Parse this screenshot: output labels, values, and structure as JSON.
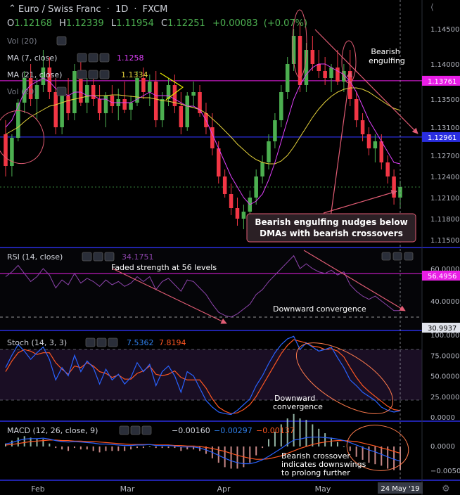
{
  "header": {
    "symbol": "Euro / Swiss Franc",
    "interval": "1D",
    "exchange": "FXCM",
    "open": "1.12168",
    "high": "1.12339",
    "low": "1.11954",
    "close": "1.12251",
    "change": "+0.00083",
    "change_pct": "(+0.07%)"
  },
  "indicators": {
    "vol1": "Vol (20)",
    "ma7": "MA (7, close)",
    "ma7_val": "1.1258",
    "ma21": "MA (21, close)",
    "ma21_val": "1.1334",
    "vol2": "Vol (20)",
    "rsi": "RSI (14, close)",
    "rsi_val": "34.1751",
    "stoch": "Stoch (14, 3, 3)",
    "stoch_k": "7.5362",
    "stoch_d": "7.8194",
    "macd": "MACD (12, 26, close, 9)",
    "macd_hist": "−0.00160",
    "macd_line": "−0.00297",
    "macd_signal": "−0.00137"
  },
  "price_axis": {
    "ticks": [
      "1.14500",
      "1.14000",
      "1.13500",
      "1.13100",
      "1.12700",
      "1.12400",
      "1.12100",
      "1.11800",
      "1.11500"
    ],
    "label_magenta": "1.13761",
    "label_blue": "1.12961"
  },
  "rsi_axis": {
    "ticks": [
      "60.0000",
      "40.0000"
    ],
    "label_magenta": "56.4956",
    "label_white": "30.9937"
  },
  "stoch_axis": {
    "ticks": [
      "100.0000",
      "75.0000",
      "50.0000",
      "25.0000",
      "0.0000"
    ]
  },
  "macd_axis": {
    "ticks": [
      "0.0000",
      "−0.0050"
    ]
  },
  "time_axis": {
    "labels": [
      "Feb",
      "Mar",
      "Apr",
      "May"
    ],
    "cursor_label": "24 May '19"
  },
  "annotations": {
    "engulf_line1": "Bearish",
    "engulf_line2": "engulfing",
    "callout_line1": "Bearish engulfing nudges below",
    "callout_line2": "DMAs with bearish crossovers",
    "rsi_note": "Faded strength at 56 levels",
    "rsi_conv": "Downward convergence",
    "stoch_conv1": "Downward",
    "stoch_conv2": "convergence",
    "macd_note1": "Bearish crossover",
    "macd_note2": "indicates downswings",
    "macd_note3": "to prolong further"
  },
  "colors": {
    "bull": "#4caf50",
    "bear": "#f23645",
    "ma7": "#e040fb",
    "ma21": "#e6d33b",
    "rsi": "#8e44ad",
    "stoch_k": "#2962ff",
    "stoch_d": "#ff5722",
    "macd_line": "#2962ff",
    "macd_signal": "#ff5722",
    "hline_magenta": "#e91ee6",
    "hline_blue": "#2a2ee0",
    "annotation": "#e15c74"
  },
  "chart_data": {
    "type": "candlestick",
    "ylim": [
      1.115,
      1.147
    ],
    "ma7_last": 1.1258,
    "ma21_last": 1.1334,
    "hlines": [
      1.13761,
      1.12961
    ],
    "candles": [
      [
        1.13,
        1.132,
        1.124,
        1.1255
      ],
      [
        1.1255,
        1.13,
        1.124,
        1.1295
      ],
      [
        1.1295,
        1.135,
        1.129,
        1.1345
      ],
      [
        1.1345,
        1.139,
        1.133,
        1.138
      ],
      [
        1.138,
        1.14,
        1.134,
        1.135
      ],
      [
        1.135,
        1.138,
        1.132,
        1.137
      ],
      [
        1.137,
        1.142,
        1.136,
        1.1395
      ],
      [
        1.1395,
        1.141,
        1.135,
        1.136
      ],
      [
        1.136,
        1.138,
        1.13,
        1.131
      ],
      [
        1.131,
        1.136,
        1.13,
        1.1355
      ],
      [
        1.1355,
        1.138,
        1.132,
        1.133
      ],
      [
        1.133,
        1.14,
        1.132,
        1.139
      ],
      [
        1.139,
        1.1405,
        1.134,
        1.1345
      ],
      [
        1.1345,
        1.138,
        1.133,
        1.137
      ],
      [
        1.137,
        1.139,
        1.134,
        1.135
      ],
      [
        1.135,
        1.137,
        1.132,
        1.133
      ],
      [
        1.133,
        1.136,
        1.131,
        1.1355
      ],
      [
        1.1355,
        1.137,
        1.133,
        1.134
      ],
      [
        1.134,
        1.1365,
        1.132,
        1.135
      ],
      [
        1.135,
        1.1375,
        1.133,
        1.1335
      ],
      [
        1.1335,
        1.1355,
        1.132,
        1.1345
      ],
      [
        1.1345,
        1.139,
        1.134,
        1.138
      ],
      [
        1.138,
        1.1395,
        1.135,
        1.136
      ],
      [
        1.136,
        1.1385,
        1.134,
        1.1375
      ],
      [
        1.1375,
        1.139,
        1.131,
        1.132
      ],
      [
        1.132,
        1.136,
        1.131,
        1.135
      ],
      [
        1.135,
        1.138,
        1.134,
        1.137
      ],
      [
        1.137,
        1.1385,
        1.133,
        1.134
      ],
      [
        1.134,
        1.136,
        1.13,
        1.131
      ],
      [
        1.131,
        1.136,
        1.1305,
        1.1355
      ],
      [
        1.1355,
        1.1375,
        1.134,
        1.136
      ],
      [
        1.136,
        1.137,
        1.1325,
        1.133
      ],
      [
        1.133,
        1.1345,
        1.13,
        1.131
      ],
      [
        1.131,
        1.133,
        1.127,
        1.128
      ],
      [
        1.128,
        1.129,
        1.123,
        1.124
      ],
      [
        1.124,
        1.125,
        1.121,
        1.1215
      ],
      [
        1.1215,
        1.123,
        1.1185,
        1.1195
      ],
      [
        1.1195,
        1.121,
        1.117,
        1.118
      ],
      [
        1.118,
        1.12,
        1.1165,
        1.119
      ],
      [
        1.119,
        1.122,
        1.1175,
        1.121
      ],
      [
        1.121,
        1.125,
        1.12,
        1.124
      ],
      [
        1.124,
        1.127,
        1.123,
        1.126
      ],
      [
        1.126,
        1.13,
        1.125,
        1.129
      ],
      [
        1.129,
        1.133,
        1.128,
        1.132
      ],
      [
        1.132,
        1.137,
        1.131,
        1.136
      ],
      [
        1.136,
        1.141,
        1.135,
        1.14
      ],
      [
        1.14,
        1.145,
        1.139,
        1.144
      ],
      [
        1.144,
        1.146,
        1.136,
        1.137
      ],
      [
        1.137,
        1.143,
        1.136,
        1.142
      ],
      [
        1.142,
        1.144,
        1.139,
        1.14
      ],
      [
        1.14,
        1.142,
        1.138,
        1.139
      ],
      [
        1.139,
        1.141,
        1.137,
        1.138
      ],
      [
        1.138,
        1.14,
        1.136,
        1.1395
      ],
      [
        1.1395,
        1.142,
        1.137,
        1.1375
      ],
      [
        1.1375,
        1.14,
        1.136,
        1.139
      ],
      [
        1.139,
        1.142,
        1.134,
        1.135
      ],
      [
        1.135,
        1.136,
        1.131,
        1.132
      ],
      [
        1.132,
        1.133,
        1.129,
        1.13
      ],
      [
        1.13,
        1.131,
        1.127,
        1.128
      ],
      [
        1.128,
        1.13,
        1.126,
        1.129
      ],
      [
        1.129,
        1.13,
        1.125,
        1.126
      ],
      [
        1.126,
        1.127,
        1.123,
        1.124
      ],
      [
        1.124,
        1.125,
        1.12,
        1.121
      ],
      [
        1.121,
        1.1234,
        1.1195,
        1.1225
      ]
    ],
    "ma7": [
      1.131,
      1.132,
      1.134,
      1.136,
      1.137,
      1.1375,
      1.138,
      1.1375,
      1.1365,
      1.136,
      1.1355,
      1.136,
      1.136,
      1.1355,
      1.1355,
      1.135,
      1.135,
      1.1345,
      1.1345,
      1.1345,
      1.1345,
      1.135,
      1.1355,
      1.136,
      1.1355,
      1.1355,
      1.1355,
      1.135,
      1.1345,
      1.134,
      1.134,
      1.1335,
      1.132,
      1.13,
      1.128,
      1.126,
      1.124,
      1.1225,
      1.121,
      1.12,
      1.1205,
      1.1215,
      1.1235,
      1.126,
      1.129,
      1.132,
      1.135,
      1.137,
      1.1385,
      1.1395,
      1.14,
      1.14,
      1.1395,
      1.139,
      1.1385,
      1.1375,
      1.136,
      1.134,
      1.132,
      1.1305,
      1.129,
      1.1275,
      1.126,
      1.1258
    ],
    "ma21": [
      1.13,
      1.1305,
      1.131,
      1.1318,
      1.1325,
      1.133,
      1.1335,
      1.134,
      1.1342,
      1.1345,
      1.1348,
      1.135,
      1.1352,
      1.1354,
      1.1355,
      1.1355,
      1.1355,
      1.1356,
      1.1356,
      1.1355,
      1.1354,
      1.1353,
      1.1352,
      1.1352,
      1.135,
      1.1348,
      1.1347,
      1.1345,
      1.1343,
      1.134,
      1.1338,
      1.1335,
      1.133,
      1.1322,
      1.1314,
      1.1305,
      1.1296,
      1.1286,
      1.1278,
      1.127,
      1.1264,
      1.126,
      1.1258,
      1.1258,
      1.1262,
      1.127,
      1.1282,
      1.1296,
      1.131,
      1.1324,
      1.1336,
      1.1346,
      1.1354,
      1.136,
      1.1364,
      1.1366,
      1.1366,
      1.1364,
      1.136,
      1.1354,
      1.1348,
      1.1342,
      1.1337,
      1.1334
    ],
    "rsi": [
      55,
      58,
      62,
      57,
      52,
      55,
      60,
      56,
      48,
      53,
      50,
      57,
      51,
      54,
      52,
      49,
      53,
      50,
      52,
      49,
      51,
      55,
      52,
      55,
      47,
      52,
      54,
      50,
      46,
      53,
      52,
      48,
      44,
      38,
      33,
      31,
      30,
      32,
      35,
      38,
      44,
      47,
      52,
      56,
      60,
      64,
      68,
      60,
      63,
      60,
      58,
      57,
      59,
      56,
      58,
      50,
      46,
      43,
      41,
      43,
      40,
      37,
      34,
      34
    ],
    "stoch_k": [
      60,
      75,
      88,
      80,
      70,
      78,
      85,
      70,
      45,
      60,
      50,
      75,
      55,
      68,
      60,
      40,
      58,
      45,
      52,
      40,
      48,
      66,
      55,
      64,
      38,
      55,
      62,
      50,
      30,
      55,
      50,
      35,
      20,
      12,
      6,
      4,
      3,
      8,
      15,
      22,
      38,
      50,
      65,
      78,
      88,
      95,
      98,
      82,
      90,
      85,
      80,
      82,
      85,
      72,
      60,
      45,
      38,
      30,
      25,
      20,
      12,
      8,
      6,
      7.5
    ],
    "stoch_d": [
      55,
      68,
      78,
      82,
      80,
      76,
      78,
      78,
      66,
      58,
      52,
      62,
      60,
      66,
      62,
      55,
      53,
      48,
      51,
      46,
      46,
      53,
      56,
      62,
      52,
      50,
      52,
      56,
      48,
      45,
      45,
      45,
      35,
      22,
      12,
      7,
      4,
      5,
      9,
      15,
      25,
      38,
      51,
      64,
      77,
      87,
      94,
      92,
      90,
      86,
      85,
      82,
      83,
      80,
      73,
      60,
      48,
      38,
      31,
      25,
      19,
      13,
      9,
      7.8
    ],
    "macd_line": [
      0.0005,
      0.0008,
      0.0012,
      0.0015,
      0.0016,
      0.0016,
      0.0017,
      0.0015,
      0.0012,
      0.001,
      0.0009,
      0.001,
      0.0009,
      0.0008,
      0.0007,
      0.0005,
      0.0005,
      0.0004,
      0.0003,
      0.0002,
      0.0002,
      0.0003,
      0.0003,
      0.0004,
      0.0002,
      0.0002,
      0.0002,
      0.0001,
      -0.0001,
      -0.0001,
      -0.0001,
      -0.0003,
      -0.0007,
      -0.0012,
      -0.0018,
      -0.0024,
      -0.0029,
      -0.0033,
      -0.0035,
      -0.0035,
      -0.0032,
      -0.0027,
      -0.002,
      -0.0012,
      -0.0004,
      0.0005,
      0.0013,
      0.0015,
      0.0018,
      0.0019,
      0.0019,
      0.0018,
      0.0017,
      0.0015,
      0.0012,
      0.0008,
      0.0003,
      -0.0002,
      -0.0007,
      -0.0011,
      -0.0016,
      -0.0021,
      -0.0026,
      -0.00297
    ],
    "macd_signal": [
      0.0003,
      0.0004,
      0.0006,
      0.0008,
      0.001,
      0.0011,
      0.0012,
      0.0013,
      0.0013,
      0.0012,
      0.0012,
      0.0011,
      0.0011,
      0.001,
      0.001,
      0.0009,
      0.0008,
      0.0007,
      0.0006,
      0.0005,
      0.0004,
      0.0004,
      0.0004,
      0.0004,
      0.0003,
      0.0003,
      0.0003,
      0.0002,
      0.0002,
      0.0001,
      0.0001,
      0.0,
      -0.0002,
      -0.0004,
      -0.0007,
      -0.001,
      -0.0014,
      -0.0018,
      -0.0021,
      -0.0024,
      -0.0026,
      -0.0026,
      -0.0025,
      -0.0022,
      -0.0019,
      -0.0014,
      -0.0009,
      -0.0004,
      0.0,
      0.0004,
      0.0007,
      0.0009,
      0.0011,
      0.0012,
      0.0012,
      0.0011,
      0.001,
      0.0007,
      0.0004,
      0.0001,
      -0.0003,
      -0.0006,
      -0.001,
      -0.00137
    ]
  }
}
